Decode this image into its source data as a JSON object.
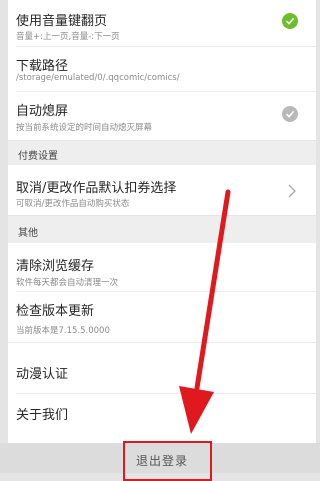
{
  "settings": {
    "volume_flip": {
      "title": "使用音量键翻页",
      "sub": "音量+:上一页,音量-:下一页",
      "checked": true
    },
    "download_path": {
      "title": "下载路径",
      "sub": "/storage/emulated/0/.qqcomic/comics/"
    },
    "auto_lock": {
      "title": "自动熄屏",
      "sub": "按当前系统设定的时间自动熄灭屏幕",
      "checked": false
    }
  },
  "paid": {
    "section_label": "付费设置",
    "auto_buy": {
      "title": "取消/更改作品默认扣券选择",
      "sub": "可取消/更改作品自动购买状态"
    }
  },
  "other": {
    "section_label": "其他",
    "clear_cache": {
      "title": "清除浏览缓存",
      "sub": "软件每天都会自动清理一次"
    },
    "check_update": {
      "title": "检查版本更新",
      "sub": "当前版本是7.15.5.0000"
    },
    "certification": {
      "title": "动漫认证"
    },
    "about": {
      "title": "关于我们"
    }
  },
  "logout": {
    "label": "退出登录"
  },
  "colors": {
    "accent_green": "#6bbf2a",
    "disabled_grey": "#b9b9b9",
    "annotation_red": "#e0191f"
  }
}
